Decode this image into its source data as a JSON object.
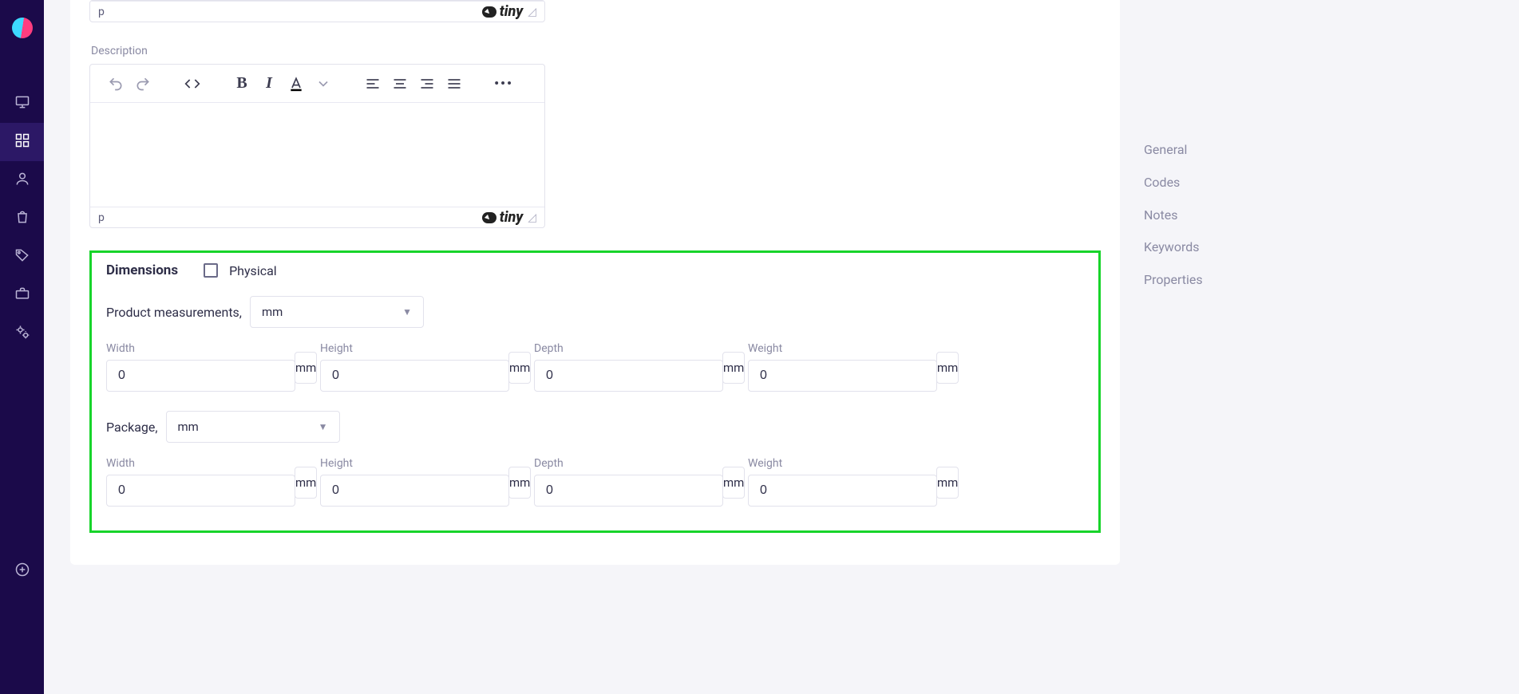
{
  "right_nav": {
    "items": [
      "General",
      "Codes",
      "Notes",
      "Keywords",
      "Properties"
    ]
  },
  "editor1": {
    "path_tag": "p",
    "brand": "tiny"
  },
  "editor2": {
    "label": "Description",
    "path_tag": "p",
    "brand": "tiny"
  },
  "dimensions": {
    "title": "Dimensions",
    "physical_label": "Physical",
    "product_measurements_label": "Product measurements,",
    "product_unit_selected": "mm",
    "package_label": "Package,",
    "package_unit_selected": "mm",
    "product_fields": [
      {
        "label": "Width",
        "value": "0",
        "unit": "mm"
      },
      {
        "label": "Height",
        "value": "0",
        "unit": "mm"
      },
      {
        "label": "Depth",
        "value": "0",
        "unit": "mm"
      },
      {
        "label": "Weight",
        "value": "0",
        "unit": "mm"
      }
    ],
    "package_fields": [
      {
        "label": "Width",
        "value": "0",
        "unit": "mm"
      },
      {
        "label": "Height",
        "value": "0",
        "unit": "mm"
      },
      {
        "label": "Depth",
        "value": "0",
        "unit": "mm"
      },
      {
        "label": "Weight",
        "value": "0",
        "unit": "mm"
      }
    ]
  }
}
